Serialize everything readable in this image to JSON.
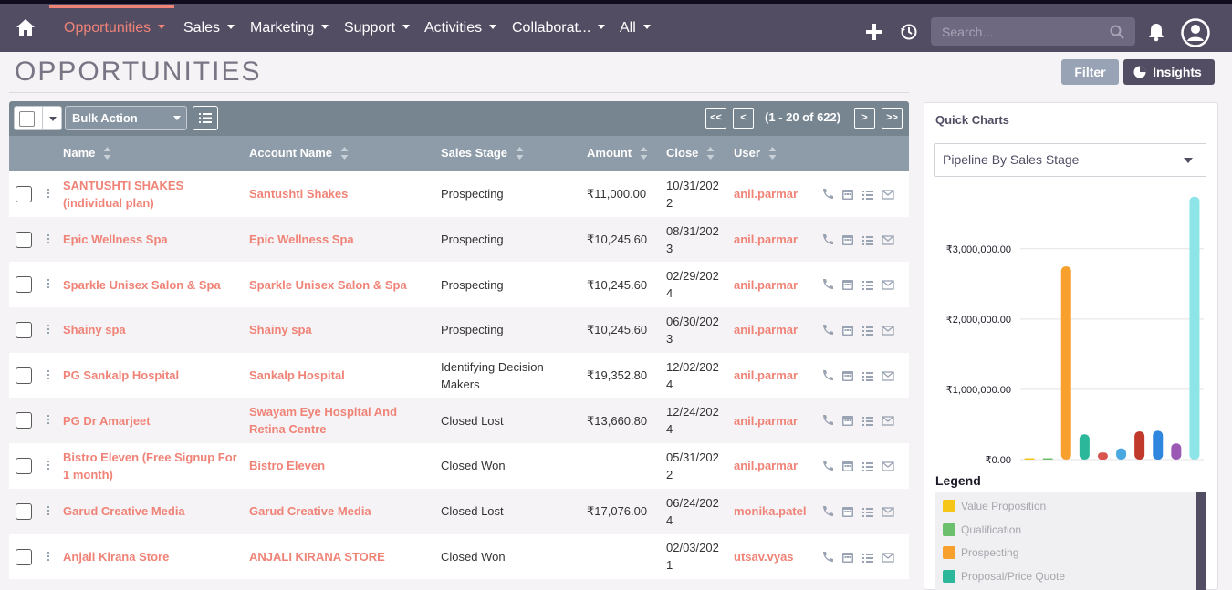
{
  "nav": {
    "items": [
      {
        "label": "Opportunities",
        "active": true
      },
      {
        "label": "Sales"
      },
      {
        "label": "Marketing"
      },
      {
        "label": "Support"
      },
      {
        "label": "Activities"
      },
      {
        "label": "Collaborat..."
      },
      {
        "label": "All"
      }
    ],
    "search_placeholder": "Search...",
    "accent_color": "#f08377",
    "bar_color": "#534d64"
  },
  "page": {
    "title": "OPPORTUNITIES",
    "filter_label": "Filter",
    "insights_label": "Insights"
  },
  "toolbar": {
    "bulk_action_label": "Bulk Action",
    "first_label": "<<",
    "prev_label": "<",
    "pagination": "(1 - 20 of 622)",
    "next_label": ">",
    "last_label": ">>"
  },
  "table": {
    "columns": [
      "Name",
      "Account Name",
      "Sales Stage",
      "Amount",
      "Close",
      "User"
    ],
    "rows": [
      {
        "name": "SANTUSHTI SHAKES (individual plan)",
        "account": "Santushti Shakes",
        "stage": "Prospecting",
        "amount": "₹11,000.00",
        "close": "10/31/2022",
        "user": "anil.parmar"
      },
      {
        "name": "Epic Wellness Spa",
        "account": "Epic Wellness Spa",
        "stage": "Prospecting",
        "amount": "₹10,245.60",
        "close": "08/31/2023",
        "user": "anil.parmar"
      },
      {
        "name": "Sparkle Unisex Salon & Spa",
        "account": "Sparkle Unisex Salon & Spa",
        "stage": "Prospecting",
        "amount": "₹10,245.60",
        "close": "02/29/2024",
        "user": "anil.parmar"
      },
      {
        "name": "Shainy spa",
        "account": "Shainy spa",
        "stage": "Prospecting",
        "amount": "₹10,245.60",
        "close": "06/30/2023",
        "user": "anil.parmar"
      },
      {
        "name": "PG Sankalp Hospital",
        "account": "Sankalp Hospital",
        "stage": "Identifying Decision Makers",
        "amount": "₹19,352.80",
        "close": "12/02/2024",
        "user": "anil.parmar"
      },
      {
        "name": "PG Dr Amarjeet",
        "account": "Swayam Eye Hospital And Retina Centre",
        "stage": "Closed Lost",
        "amount": "₹13,660.80",
        "close": "12/24/2024",
        "user": "anil.parmar"
      },
      {
        "name": "Bistro Eleven (Free Signup For 1 month)",
        "account": "Bistro Eleven",
        "stage": "Closed Won",
        "amount": "",
        "close": "05/31/2022",
        "user": "anil.parmar"
      },
      {
        "name": "Garud Creative Media",
        "account": "Garud Creative Media",
        "stage": "Closed Lost",
        "amount": "₹17,076.00",
        "close": "06/24/2024",
        "user": "monika.patel"
      },
      {
        "name": "Anjali Kirana Store",
        "account": "ANJALI KIRANA STORE",
        "stage": "Closed Won",
        "amount": "",
        "close": "02/03/2021",
        "user": "utsav.vyas"
      }
    ]
  },
  "quick_charts": {
    "title": "Quick Charts",
    "selected_chart": "Pipeline By Sales Stage",
    "legend_title": "Legend",
    "legend": [
      {
        "label": "Value Proposition",
        "color": "#f5c518"
      },
      {
        "label": "Qualification",
        "color": "#6cbf6c"
      },
      {
        "label": "Prospecting",
        "color": "#f7a02d"
      },
      {
        "label": "Proposal/Price Quote",
        "color": "#2bb89a"
      }
    ]
  },
  "chart_data": {
    "type": "bar",
    "ylim": [
      0,
      3750000
    ],
    "ytick_labels": [
      "₹0.00",
      "₹1,000,000.00",
      "₹2,000,000.00",
      "₹3,000,000.00"
    ],
    "yticks": [
      0,
      1000000,
      2000000,
      3000000
    ],
    "grid": true,
    "series": [
      {
        "color": "#f5c518",
        "value": 4000
      },
      {
        "color": "#6cbf6c",
        "value": 4000
      },
      {
        "color": "#f7a02d",
        "value": 2750000
      },
      {
        "color": "#2bb89a",
        "value": 360000
      },
      {
        "color": "#d9534f",
        "value": 100000
      },
      {
        "color": "#4aa8e0",
        "value": 160000
      },
      {
        "color": "#c0392b",
        "value": 400000
      },
      {
        "color": "#2e86de",
        "value": 410000
      },
      {
        "color": "#9b59b6",
        "value": 230000
      },
      {
        "color": "#8ee5e8",
        "value": 3740000
      }
    ]
  }
}
